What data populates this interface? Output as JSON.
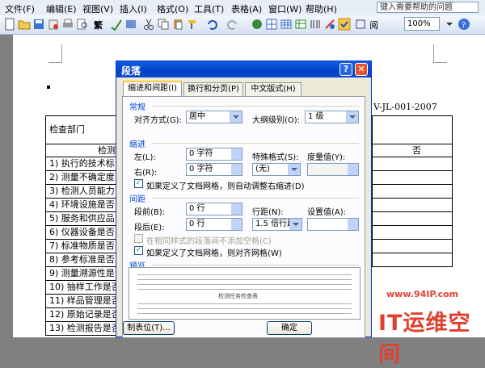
{
  "menubar": {
    "items": [
      "文件(F)",
      "编辑(E)",
      "视图(V)",
      "插入(I)",
      "格式(O)",
      "工具(T)",
      "表格(A)",
      "窗口(W)",
      "帮助(H)"
    ],
    "help_placeholder": "键入需要帮助的问题"
  },
  "toolbar": {
    "zoom": "100%",
    "read_label": "阅",
    "fan_label": "繁"
  },
  "document": {
    "doc_code": "V-JL-001-2007",
    "header_label": "检查部门",
    "col_head": "检测",
    "no_head": "否",
    "rows": [
      "1) 执行的技术标",
      "2) 测量不确定度",
      "3) 检测人员能力",
      "4) 环境设施是否",
      "5) 服务和供应品",
      "6) 仪器设备是否",
      "7) 标准物质是否",
      "8) 参考标准是否",
      "9) 测量溯源性是",
      "10) 抽样工作是否",
      "11) 样品管理是否",
      "12) 原始记录是否",
      "13) 检测报告是否"
    ]
  },
  "dialog": {
    "title": "段落",
    "tabs": [
      "缩进和间距(I)",
      "换行和分页(P)",
      "中文版式(H)"
    ],
    "general": {
      "label": "常规",
      "align_label": "对齐方式(G):",
      "align_value": "居中",
      "outline_label": "大纲级别(O):",
      "outline_value": "1 级"
    },
    "indent": {
      "label": "缩进",
      "left_label": "左(L):",
      "left_value": "0 字符",
      "right_label": "右(R):",
      "right_value": "0 字符",
      "special_label": "特殊格式(S):",
      "special_value": "(无)",
      "by_label": "度量值(Y):",
      "grid_check": "如果定义了文档网格，则自动调整右缩进(D)"
    },
    "spacing": {
      "label": "间距",
      "before_label": "段前(B):",
      "before_value": "0 行",
      "after_label": "段后(E):",
      "after_value": "0 行",
      "line_label": "行距(N):",
      "line_value": "1.5 倍行距",
      "at_label": "设置值(A):",
      "no_space_check": "在相同样式的段落间不添加空格(C)",
      "snap_check": "如果定义了文档网格，则对齐网格(W)"
    },
    "preview": {
      "label": "预览",
      "sample_text": "检测任务检查表"
    },
    "buttons": {
      "tabs": "制表位(T)...",
      "ok": "确定"
    }
  },
  "watermark": {
    "site": "www.94IP.com",
    "brand": "IT运维空间"
  },
  "colors": {
    "title_bar": "#0a5fe3",
    "dialog_bg": "#ece9d8",
    "menu_bg": "#e8eef8",
    "watermark": "#e04030"
  }
}
